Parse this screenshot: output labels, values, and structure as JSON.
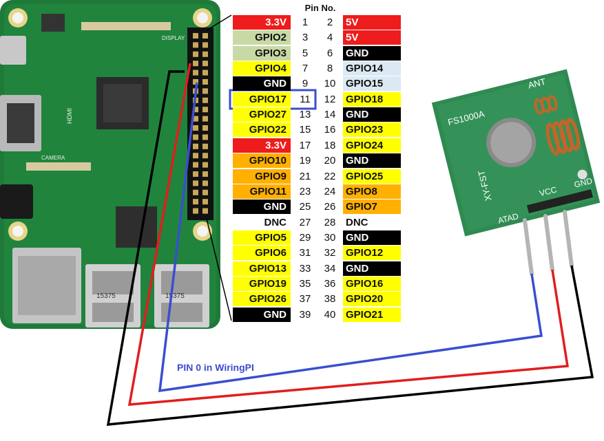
{
  "header": {
    "title": "Pin No."
  },
  "colors": {
    "power3v3": "#ee1c1c",
    "power5v": "#ee1c1c",
    "gpio_i2c": "#c8d9a6",
    "gpio": "#ffff00",
    "gnd": "#000000",
    "uart": "#dbe9f3",
    "spi": "#ffb000",
    "dnc": "#ffffff",
    "wire_black": "#000000",
    "wire_red": "#e01e1e",
    "wire_blue": "#3a4ecf"
  },
  "pins": [
    {
      "left": "3.3V",
      "lt": "power3v3",
      "ln": "1",
      "rn": "2",
      "right": "5V",
      "rt": "power5v"
    },
    {
      "left": "GPIO2",
      "lt": "gpio_i2c",
      "ln": "3",
      "rn": "4",
      "right": "5V",
      "rt": "power5v"
    },
    {
      "left": "GPIO3",
      "lt": "gpio_i2c",
      "ln": "5",
      "rn": "6",
      "right": "GND",
      "rt": "gnd"
    },
    {
      "left": "GPIO4",
      "lt": "gpio",
      "ln": "7",
      "rn": "8",
      "right": "GPIO14",
      "rt": "uart"
    },
    {
      "left": "GND",
      "lt": "gnd",
      "ln": "9",
      "rn": "10",
      "right": "GPIO15",
      "rt": "uart"
    },
    {
      "left": "GPIO17",
      "lt": "gpio",
      "ln": "11",
      "rn": "12",
      "right": "GPIO18",
      "rt": "gpio"
    },
    {
      "left": "GPIO27",
      "lt": "gpio",
      "ln": "13",
      "rn": "14",
      "right": "GND",
      "rt": "gnd"
    },
    {
      "left": "GPIO22",
      "lt": "gpio",
      "ln": "15",
      "rn": "16",
      "right": "GPIO23",
      "rt": "gpio"
    },
    {
      "left": "3.3V",
      "lt": "power3v3",
      "ln": "17",
      "rn": "18",
      "right": "GPIO24",
      "rt": "gpio"
    },
    {
      "left": "GPIO10",
      "lt": "spi",
      "ln": "19",
      "rn": "20",
      "right": "GND",
      "rt": "gnd"
    },
    {
      "left": "GPIO9",
      "lt": "spi",
      "ln": "21",
      "rn": "22",
      "right": "GPIO25",
      "rt": "gpio"
    },
    {
      "left": "GPIO11",
      "lt": "spi",
      "ln": "23",
      "rn": "24",
      "right": "GPIO8",
      "rt": "spi"
    },
    {
      "left": "GND",
      "lt": "gnd",
      "ln": "25",
      "rn": "26",
      "right": "GPIO7",
      "rt": "spi"
    },
    {
      "left": "DNC",
      "lt": "dnc",
      "ln": "27",
      "rn": "28",
      "right": "DNC",
      "rt": "dnc"
    },
    {
      "left": "GPIO5",
      "lt": "gpio",
      "ln": "29",
      "rn": "30",
      "right": "GND",
      "rt": "gnd"
    },
    {
      "left": "GPIO6",
      "lt": "gpio",
      "ln": "31",
      "rn": "32",
      "right": "GPIO12",
      "rt": "gpio"
    },
    {
      "left": "GPIO13",
      "lt": "gpio",
      "ln": "33",
      "rn": "34",
      "right": "GND",
      "rt": "gnd"
    },
    {
      "left": "GPIO19",
      "lt": "gpio",
      "ln": "35",
      "rn": "36",
      "right": "GPIO16",
      "rt": "gpio"
    },
    {
      "left": "GPIO26",
      "lt": "gpio",
      "ln": "37",
      "rn": "38",
      "right": "GPIO20",
      "rt": "gpio"
    },
    {
      "left": "GND",
      "lt": "gnd",
      "ln": "39",
      "rn": "40",
      "right": "GPIO21",
      "rt": "gpio"
    }
  ],
  "highlight": {
    "pin_number": "11",
    "label": "GPIO17"
  },
  "annotation": {
    "wiringpi": "PIN 0 in WiringPI"
  },
  "module": {
    "model": "FS1000A",
    "name": "XY-FST",
    "ant": "ANT",
    "pin_atad": "ATAD",
    "pin_vcc": "VCC",
    "pin_gnd": "GND"
  },
  "board": {
    "usb_label_1": "15375",
    "usb_label_2": "15375",
    "hdmi": "HDMI",
    "display": "DISPLAY",
    "camera": "CAMERA"
  }
}
